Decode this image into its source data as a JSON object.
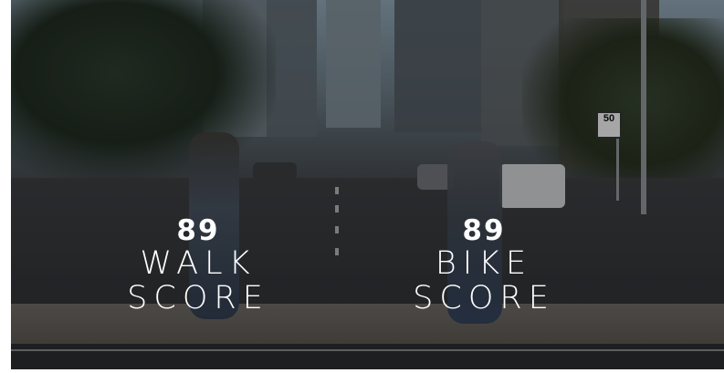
{
  "hero": {
    "walk": {
      "score": "89",
      "label_line1": "WALK",
      "label_line2": "SCORE"
    },
    "bike": {
      "score": "89",
      "label_line1": "BIKE",
      "label_line2": "SCORE"
    }
  },
  "scene": {
    "speed_sign": "50"
  },
  "colors": {
    "score_text": "#ffffff",
    "page_background": "#ffffff"
  }
}
